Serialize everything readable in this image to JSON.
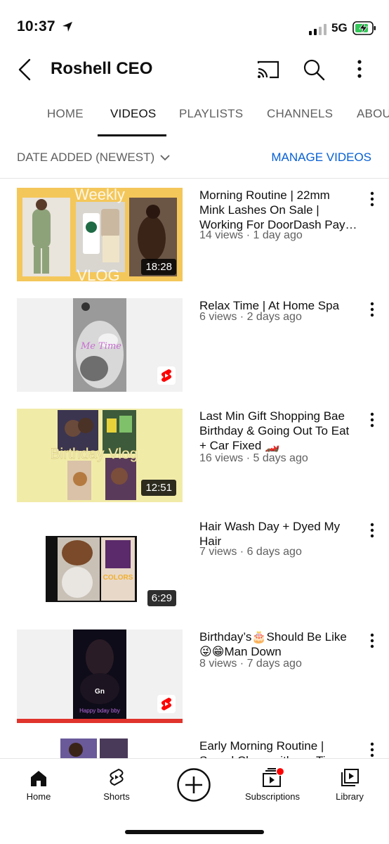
{
  "status_bar": {
    "time": "10:37",
    "network": "5G"
  },
  "header": {
    "title": "Roshell CEO"
  },
  "tabs": [
    {
      "label": "HOME"
    },
    {
      "label": "VIDEOS"
    },
    {
      "label": "PLAYLISTS"
    },
    {
      "label": "CHANNELS"
    },
    {
      "label": "ABOUT"
    }
  ],
  "sort": {
    "label": "DATE ADDED (NEWEST)",
    "manage_label": "MANAGE VIDEOS"
  },
  "videos": [
    {
      "title": "Morning Routine | 22mm Mink Lashes On Sale | Working For DoorDash Pay…",
      "meta": "14 views · 1 day ago",
      "duration": "18:28",
      "thumb_top": "Weekly",
      "thumb_bottom": "VLOG"
    },
    {
      "title": "Relax Time | At Home Spa",
      "meta": "6 views · 2 days ago",
      "thumb_text": "Me Time"
    },
    {
      "title": "Last Min Gift Shopping Bae Birthday & Going Out To Eat + Car Fixed 🏎️",
      "meta": "16 views · 5 days ago",
      "duration": "12:51",
      "thumb_text": "Birthday Vlog"
    },
    {
      "title": "Hair Wash Day + Dyed My Hair",
      "meta": "7 views · 6 days ago",
      "duration": "6:29",
      "thumb_text": "COLORS"
    },
    {
      "title": "Birthday’s🎂Should Be Like 😜😁Man Down",
      "meta": "8 views · 7 days ago",
      "thumb_text": "Gn",
      "thumb_caption": "Happy bday bby"
    },
    {
      "title": "Early Morning Routine | Speed Clean with me Time",
      "meta": ""
    }
  ],
  "bottom_nav": {
    "home": "Home",
    "shorts": "Shorts",
    "subscriptions": "Subscriptions",
    "library": "Library"
  },
  "colors": {
    "accent_blue": "#065fd4",
    "youtube_red": "#ff0000",
    "secondary_text": "#606060"
  },
  "icons": [
    "back-icon",
    "cast-icon",
    "search-icon",
    "more-vert-icon",
    "chevron-down-icon",
    "shorts-icon",
    "home-icon",
    "create-icon",
    "subscriptions-icon",
    "library-icon"
  ]
}
